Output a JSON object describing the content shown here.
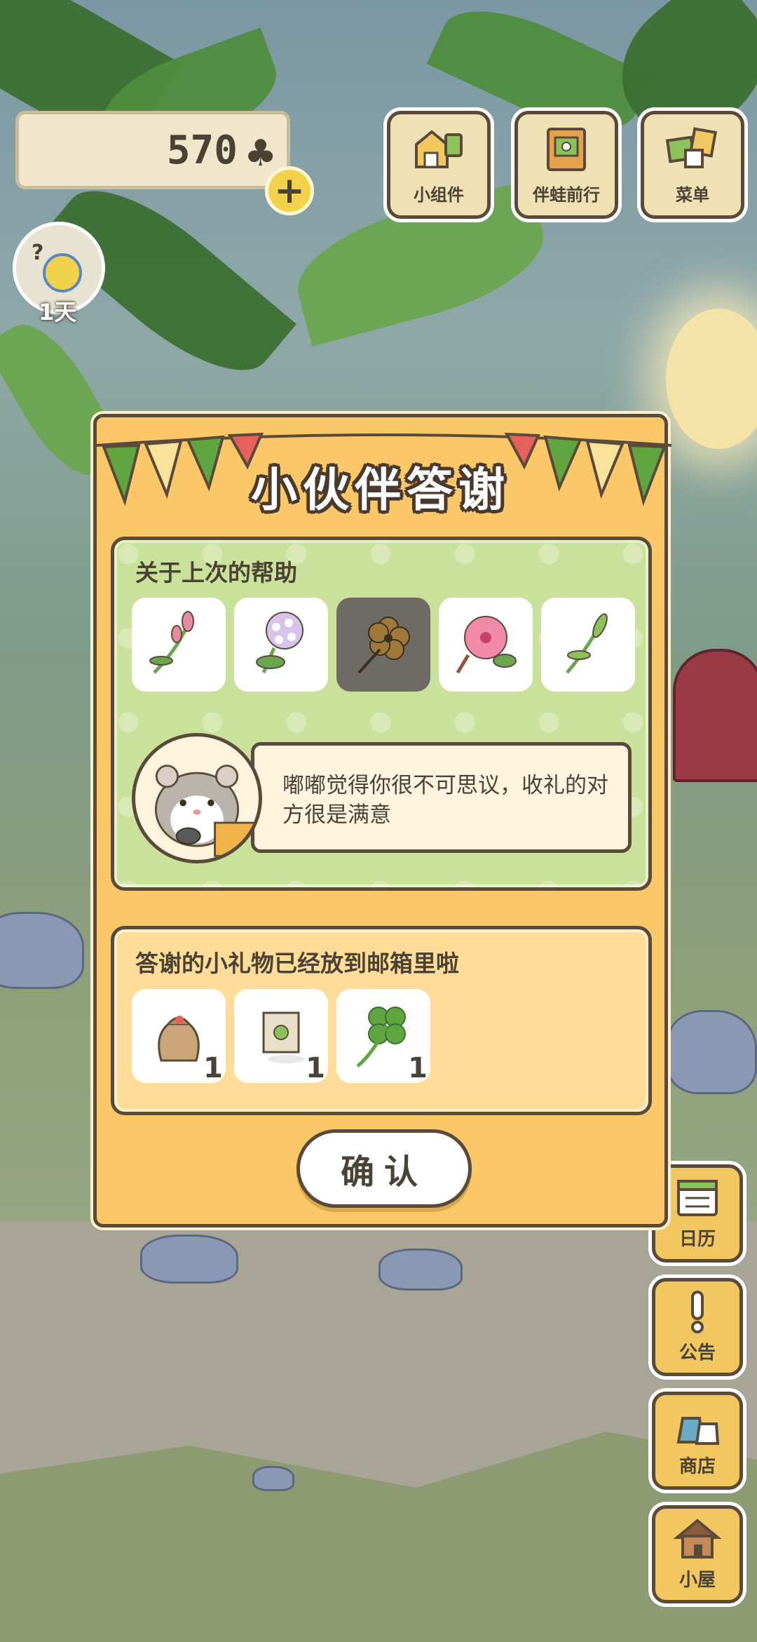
{
  "hud": {
    "clover_count": "570",
    "day_counter": "1天"
  },
  "top_buttons": [
    {
      "label": "小组件"
    },
    {
      "label": "伴蛙前行"
    },
    {
      "label": "菜单"
    }
  ],
  "side_buttons": [
    {
      "label": "日历"
    },
    {
      "label": "公告"
    },
    {
      "label": "商店"
    },
    {
      "label": "小屋"
    }
  ],
  "dialog": {
    "title": "小伙伴答谢",
    "help_section": {
      "heading": "关于上次的帮助",
      "plants": [
        {
          "name": "pink-sprig",
          "selected": false
        },
        {
          "name": "lilac",
          "selected": false
        },
        {
          "name": "brown-flower",
          "selected": true
        },
        {
          "name": "hibiscus",
          "selected": false
        },
        {
          "name": "green-sprig",
          "selected": false
        }
      ],
      "message": "嘟嘟觉得你很不可思议，收礼的对方很是满意"
    },
    "gift_section": {
      "heading": "答谢的小礼物已经放到邮箱里啦",
      "gifts": [
        {
          "name": "seed-bag",
          "qty": "1"
        },
        {
          "name": "flower-seed-packet",
          "qty": "1"
        },
        {
          "name": "four-leaf-clover",
          "qty": "1"
        }
      ]
    },
    "confirm_label": "确认"
  },
  "colors": {
    "dialog_bg": "#fbc869",
    "help_panel_bg": "#c9e19a",
    "gift_panel_bg": "#ffdd99",
    "outline": "#5a4a3a"
  }
}
